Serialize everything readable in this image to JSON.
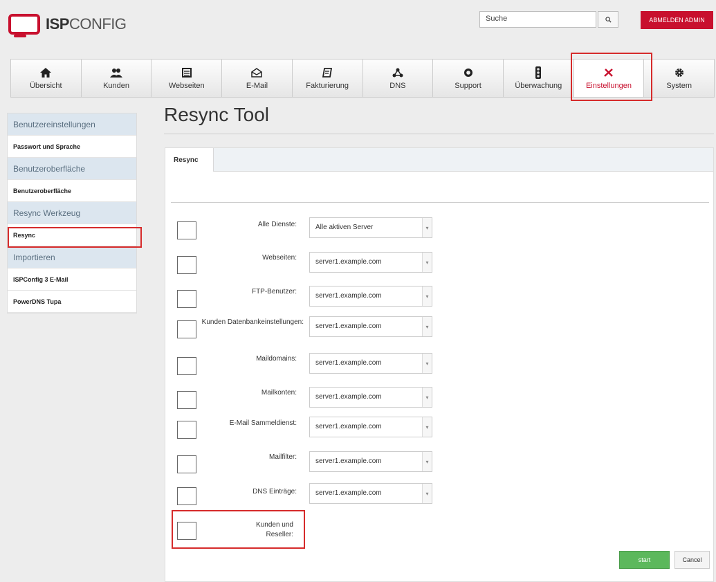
{
  "header": {
    "logo_bold": "ISP",
    "logo_light": "CONFIG",
    "search_placeholder": "Suche",
    "logout_label": "ABMELDEN ADMIN"
  },
  "nav": [
    {
      "label": "Übersicht",
      "icon": "home-icon"
    },
    {
      "label": "Kunden",
      "icon": "users-icon"
    },
    {
      "label": "Webseiten",
      "icon": "window-icon"
    },
    {
      "label": "E-Mail",
      "icon": "mail-icon"
    },
    {
      "label": "Fakturierung",
      "icon": "invoice-icon"
    },
    {
      "label": "DNS",
      "icon": "network-icon"
    },
    {
      "label": "Support",
      "icon": "lifebuoy-icon"
    },
    {
      "label": "Überwachung",
      "icon": "traffic-light-icon"
    },
    {
      "label": "Einstellungen",
      "icon": "tools-icon",
      "active": true
    },
    {
      "label": "System",
      "icon": "gear-icon"
    }
  ],
  "sidebar": {
    "sections": [
      {
        "head": "Benutzereinstellungen",
        "items": [
          "Passwort und Sprache"
        ]
      },
      {
        "head": "Benutzeroberfläche",
        "items": [
          "Benutzeroberfläche"
        ]
      },
      {
        "head": "Resync Werkzeug",
        "items": [
          "Resync"
        ]
      },
      {
        "head": "Importieren",
        "items": [
          "ISPConfig 3 E-Mail",
          "PowerDNS Tupa"
        ]
      }
    ]
  },
  "main": {
    "title": "Resync Tool",
    "tab": "Resync",
    "rows": [
      {
        "label": "Alle Dienste:",
        "value": "Alle aktiven Server"
      },
      {
        "label": "Webseiten:",
        "value": "server1.example.com"
      },
      {
        "label": "FTP-Benutzer:",
        "value": "server1.example.com"
      },
      {
        "label": "Kunden Datenbankeinstellungen:",
        "value": "server1.example.com"
      },
      {
        "label": "Maildomains:",
        "value": "server1.example.com"
      },
      {
        "label": "Mailkonten:",
        "value": "server1.example.com"
      },
      {
        "label": "E-Mail Sammeldienst:",
        "value": "server1.example.com"
      },
      {
        "label": "Mailfilter:",
        "value": "server1.example.com"
      },
      {
        "label": "DNS Einträge:",
        "value": "server1.example.com"
      },
      {
        "label": "Kunden und Reseller:",
        "value": null
      }
    ],
    "start_label": "start",
    "cancel_label": "Cancel"
  },
  "colors": {
    "accent_red": "#c8102e",
    "start_green": "#5cb85c",
    "sidebar_head_bg": "#dce6ef"
  }
}
